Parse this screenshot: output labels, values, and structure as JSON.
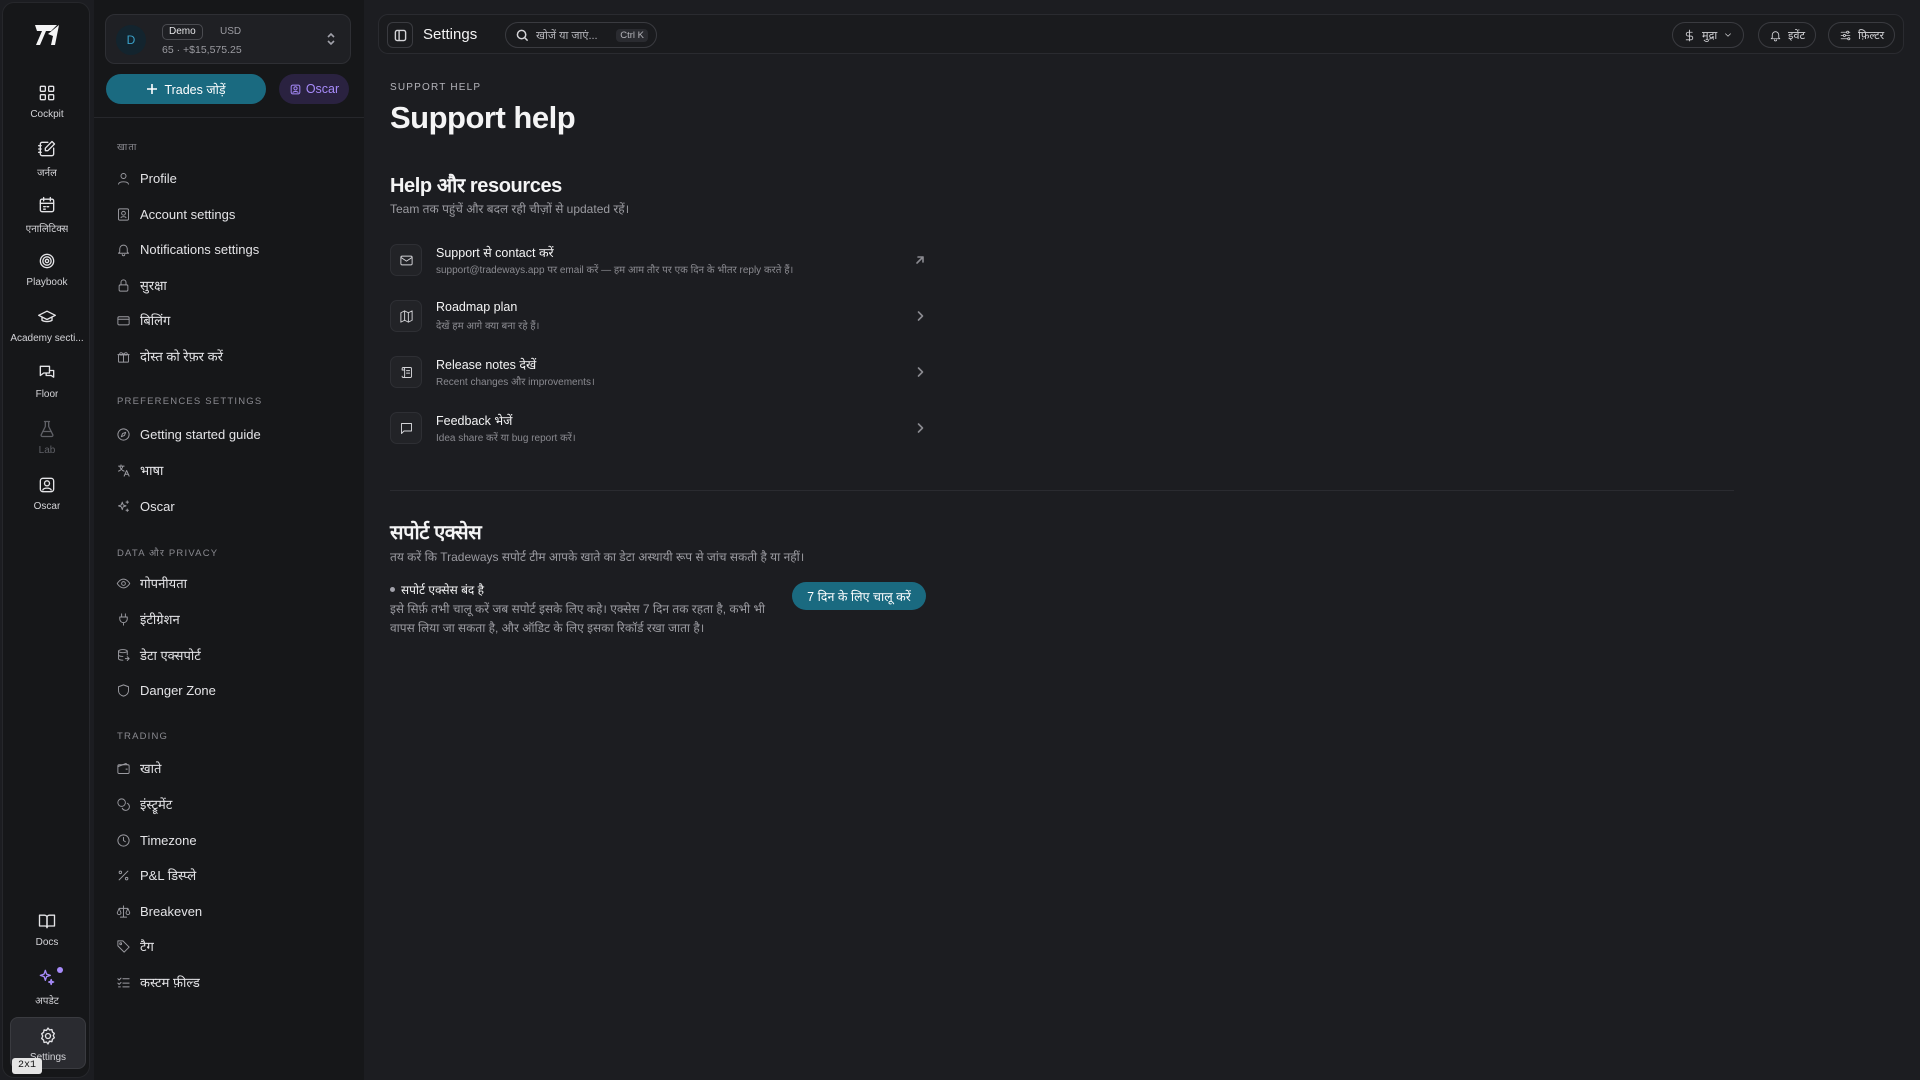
{
  "rail": {
    "items": [
      {
        "label": "Cockpit",
        "icon": "grid-icon"
      },
      {
        "label": "जर्नल",
        "icon": "journal-edit-icon"
      },
      {
        "label": "एनालिटिक्स",
        "icon": "calendar-icon"
      },
      {
        "label": "Playbook",
        "icon": "target-icon"
      },
      {
        "label": "Academy secti...",
        "icon": "graduation-cap-icon"
      },
      {
        "label": "Floor",
        "icon": "chat-bubbles-icon"
      },
      {
        "label": "Lab",
        "icon": "flask-icon"
      },
      {
        "label": "Oscar",
        "icon": "oscar-icon"
      }
    ],
    "bottom": [
      {
        "label": "Docs",
        "icon": "book-icon"
      },
      {
        "label": "अपडेट",
        "icon": "sparkle-icon"
      },
      {
        "label": "Settings",
        "icon": "gear-icon"
      }
    ],
    "kbd_badge": "2x1"
  },
  "account": {
    "avatar": "D",
    "mode": "Demo",
    "currency": "USD",
    "balance": "65 · +$15,575.25"
  },
  "actions": {
    "add_trades": "Trades जोड़ें",
    "oscar": "Oscar"
  },
  "sections": [
    {
      "heading": "खाता",
      "items": [
        {
          "label": "Profile",
          "icon": "user-icon"
        },
        {
          "label": "Account settings",
          "icon": "account-card-icon"
        },
        {
          "label": "Notifications settings",
          "icon": "bell-icon"
        },
        {
          "label": "सुरक्षा",
          "icon": "lock-icon"
        },
        {
          "label": "बिलिंग",
          "icon": "credit-card-icon"
        },
        {
          "label": "दोस्त को रेफ़र करें",
          "icon": "gift-icon"
        }
      ]
    },
    {
      "heading": "Preferences settings",
      "items": [
        {
          "label": "Getting started guide",
          "icon": "compass-icon"
        },
        {
          "label": "भाषा",
          "icon": "translate-icon"
        },
        {
          "label": "Oscar",
          "icon": "sparkles-icon"
        }
      ]
    },
    {
      "heading": "Data और Privacy",
      "items": [
        {
          "label": "गोपनीयता",
          "icon": "eye-icon"
        },
        {
          "label": "इंटीग्रेशन",
          "icon": "plug-icon"
        },
        {
          "label": "डेटा एक्सपोर्ट",
          "icon": "database-export-icon"
        },
        {
          "label": "Danger Zone",
          "icon": "shield-icon"
        }
      ]
    },
    {
      "heading": "Trading",
      "items": [
        {
          "label": "खाते",
          "icon": "wallet-icon"
        },
        {
          "label": "इंस्ट्रूमेंट",
          "icon": "coins-icon"
        },
        {
          "label": "Timezone",
          "icon": "clock-icon"
        },
        {
          "label": "P&L डिस्प्ले",
          "icon": "percent-icon"
        },
        {
          "label": "Breakeven",
          "icon": "scale-icon"
        },
        {
          "label": "टैग",
          "icon": "tag-icon"
        },
        {
          "label": "कस्टम फ़ील्ड",
          "icon": "list-checks-icon"
        }
      ]
    }
  ],
  "topbar": {
    "title": "Settings",
    "search_placeholder": "खोजें या जाएं...",
    "search_kbd": "Ctrl K",
    "currency_btn": "मुद्रा",
    "events_btn": "इवेंट",
    "filter_btn": "फ़िल्टर"
  },
  "page": {
    "eyebrow": "SUPPORT HELP",
    "title": "Support help",
    "help_heading": "Help और resources",
    "help_sub": "Team तक पहुंचें और बदल रही चीज़ों से updated रहें।",
    "resources": [
      {
        "title": "Support से contact करें",
        "desc": "support@tradeways.app पर email करें — हम आम तौर पर एक दिन के भीतर reply करते हैं।",
        "icon": "mail-icon",
        "arrow": "external-link-icon"
      },
      {
        "title": "Roadmap plan",
        "desc": "देखें हम आगे क्या बना रहे हैं।",
        "icon": "map-icon",
        "arrow": "chevron-right-icon"
      },
      {
        "title": "Release notes देखें",
        "desc": "Recent changes और improvements।",
        "icon": "scroll-icon",
        "arrow": "chevron-right-icon"
      },
      {
        "title": "Feedback भेजें",
        "desc": "Idea share करें या bug report करें।",
        "icon": "message-square-icon",
        "arrow": "chevron-right-icon"
      }
    ],
    "access_heading": "सपोर्ट एक्सेस",
    "access_sub": "तय करें कि Tradeways सपोर्ट टीम आपके खाते का डेटा अस्थायी रूप से जांच सकती है या नहीं।",
    "access_status": "सपोर्ट एक्सेस बंद है",
    "access_desc": "इसे सिर्फ़ तभी चालू करें जब सपोर्ट इसके लिए कहे। एक्सेस 7 दिन तक रहता है, कभी भी वापस लिया जा सकता है, और ऑडिट के लिए इसका रिकॉर्ड रखा जाता है।",
    "enable_btn": "7 दिन के लिए चालू करें"
  },
  "colors": {
    "accent": "#1a6a80",
    "oscar": "#a78bfa",
    "bg": "#1c1d21",
    "panel": "#161719"
  }
}
